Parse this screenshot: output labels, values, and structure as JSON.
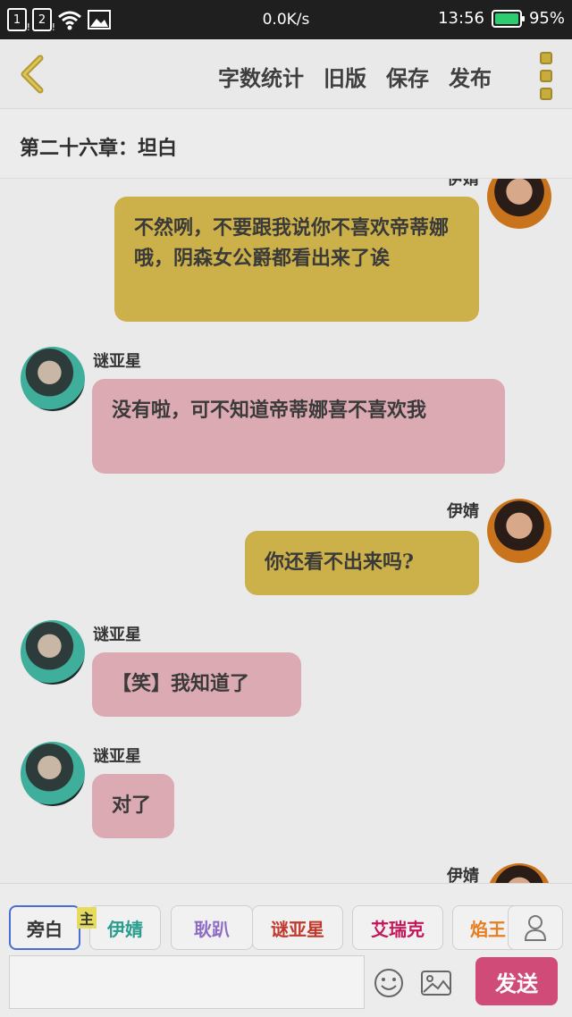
{
  "status_bar": {
    "sim1": "1",
    "sim2": "2",
    "speed": "0.0K/s",
    "time": "13:56",
    "battery": "95%"
  },
  "header": {
    "actions": [
      "字数统计",
      "旧版",
      "保存",
      "发布"
    ]
  },
  "chapter": {
    "title": "第二十六章：坦白"
  },
  "messages": [
    {
      "speaker": "伊婧",
      "text": "不然咧，不要跟我说你不喜欢帝蒂娜哦，阴森女公爵都看出来了诶"
    },
    {
      "speaker": "谜亚星",
      "text": "没有啦，可不知道帝蒂娜喜不喜欢我"
    },
    {
      "speaker": "伊婧",
      "text": "你还看不出来吗?"
    },
    {
      "speaker": "谜亚星",
      "text": "【笑】我知道了"
    },
    {
      "speaker": "谜亚星",
      "text": "对了"
    },
    {
      "speaker": "伊婧",
      "text": ""
    }
  ],
  "toolbar": {
    "characters": [
      {
        "label": "旁白",
        "color": "#555555"
      },
      {
        "label": "伊婧",
        "color": "#2a9d8f"
      },
      {
        "label": "耿趴",
        "color": "#8e6bc4"
      },
      {
        "label": "谜亚星",
        "color": "#c0392b"
      },
      {
        "label": "艾瑞克",
        "color": "#c2185b"
      },
      {
        "label": "焰王",
        "color": "#e67e22"
      }
    ],
    "main_badge": "主",
    "input_value": "",
    "send_label": "发送"
  }
}
